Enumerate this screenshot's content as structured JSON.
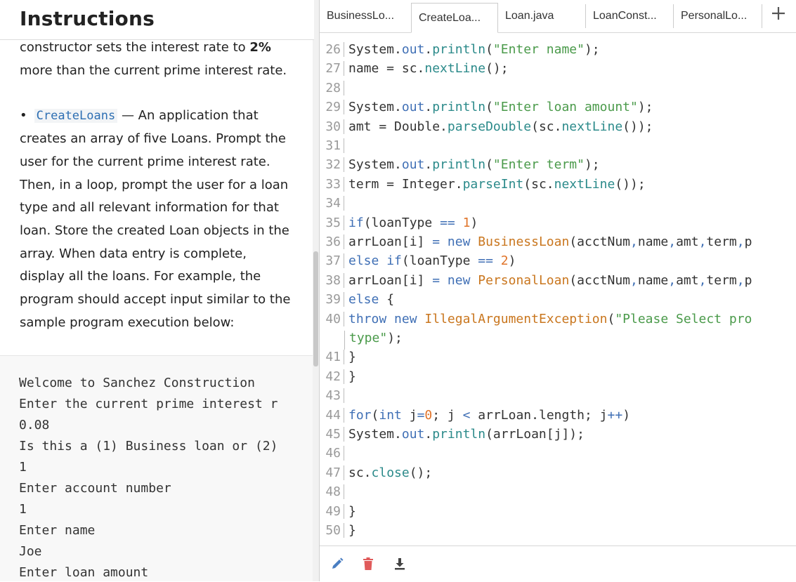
{
  "instructions": {
    "title": "Instructions",
    "para1_line1_text": "constructor sets the interest rate to ",
    "para1_line1_bold": "2%",
    "para1_line2": "more than the current prime interest rate.",
    "bullet": "•",
    "class_name": "CreateLoans",
    "bullet_line1_rest": " — An application that",
    "bullet_lines": [
      "creates an array of five Loans. Prompt the",
      "user for the current prime interest rate.",
      "Then, in a loop, prompt the user for a loan",
      "type and all relevant information for that",
      "loan. Store the created Loan objects in the",
      "array. When data entry is complete,",
      "display all the loans. For example, the",
      "program should accept input similar to the",
      "sample program execution below:"
    ]
  },
  "sample_output": [
    "Welcome to Sanchez Construction",
    "Enter the current prime interest r",
    "0.08",
    "Is this a (1) Business loan or (2)",
    "1",
    "Enter account number",
    "1",
    "Enter name",
    "Joe",
    "Enter loan amount"
  ],
  "tabs": [
    {
      "label": "BusinessLo..."
    },
    {
      "label": "CreateLoa..."
    },
    {
      "label": "Loan.java"
    },
    {
      "label": "LoanConst..."
    },
    {
      "label": "PersonalLo..."
    }
  ],
  "add_tab_icon": "plus-icon",
  "code_lines": [
    {
      "num": "26",
      "segs": [
        [
          "System.",
          ""
        ],
        [
          "out",
          "k"
        ],
        [
          ".",
          ""
        ],
        [
          "println",
          "m"
        ],
        [
          "(",
          ""
        ],
        [
          "\"Enter name\"",
          "s"
        ],
        [
          ");",
          ""
        ]
      ]
    },
    {
      "num": "27",
      "segs": [
        [
          "name = sc.",
          ""
        ],
        [
          "nextLine",
          "m"
        ],
        [
          "();",
          ""
        ]
      ]
    },
    {
      "num": "28",
      "segs": []
    },
    {
      "num": "29",
      "segs": [
        [
          "System.",
          ""
        ],
        [
          "out",
          "k"
        ],
        [
          ".",
          ""
        ],
        [
          "println",
          "m"
        ],
        [
          "(",
          ""
        ],
        [
          "\"Enter loan amount\"",
          "s"
        ],
        [
          ");",
          ""
        ]
      ]
    },
    {
      "num": "30",
      "segs": [
        [
          "amt = Double.",
          ""
        ],
        [
          "parseDouble",
          "m"
        ],
        [
          "(sc.",
          ""
        ],
        [
          "nextLine",
          "m"
        ],
        [
          "());",
          ""
        ]
      ]
    },
    {
      "num": "31",
      "segs": []
    },
    {
      "num": "32",
      "segs": [
        [
          "System.",
          ""
        ],
        [
          "out",
          "k"
        ],
        [
          ".",
          ""
        ],
        [
          "println",
          "m"
        ],
        [
          "(",
          ""
        ],
        [
          "\"Enter term\"",
          "s"
        ],
        [
          ");",
          ""
        ]
      ]
    },
    {
      "num": "33",
      "segs": [
        [
          "term = Integer.",
          ""
        ],
        [
          "parseInt",
          "m"
        ],
        [
          "(sc.",
          ""
        ],
        [
          "nextLine",
          "m"
        ],
        [
          "());",
          ""
        ]
      ]
    },
    {
      "num": "34",
      "segs": []
    },
    {
      "num": "35",
      "segs": [
        [
          "if",
          "k"
        ],
        [
          "(loanType ",
          ""
        ],
        [
          "==",
          "p"
        ],
        [
          " ",
          ""
        ],
        [
          "1",
          "n"
        ],
        [
          ")",
          ""
        ]
      ]
    },
    {
      "num": "36",
      "segs": [
        [
          "arrLoan[i] ",
          ""
        ],
        [
          "=",
          "p"
        ],
        [
          " ",
          ""
        ],
        [
          "new",
          "k"
        ],
        [
          " ",
          ""
        ],
        [
          "BusinessLoan",
          "t"
        ],
        [
          "(acctNum",
          ""
        ],
        [
          ",",
          "p"
        ],
        [
          "name",
          ""
        ],
        [
          ",",
          "p"
        ],
        [
          "amt",
          ""
        ],
        [
          ",",
          "p"
        ],
        [
          "term",
          ""
        ],
        [
          ",",
          "p"
        ],
        [
          "p",
          ""
        ]
      ]
    },
    {
      "num": "37",
      "segs": [
        [
          "else",
          "k"
        ],
        [
          " ",
          ""
        ],
        [
          "if",
          "k"
        ],
        [
          "(loanType ",
          ""
        ],
        [
          "==",
          "p"
        ],
        [
          " ",
          ""
        ],
        [
          "2",
          "n"
        ],
        [
          ")",
          ""
        ]
      ]
    },
    {
      "num": "38",
      "segs": [
        [
          "arrLoan[i] ",
          ""
        ],
        [
          "=",
          "p"
        ],
        [
          " ",
          ""
        ],
        [
          "new",
          "k"
        ],
        [
          " ",
          ""
        ],
        [
          "PersonalLoan",
          "t"
        ],
        [
          "(acctNum",
          ""
        ],
        [
          ",",
          "p"
        ],
        [
          "name",
          ""
        ],
        [
          ",",
          "p"
        ],
        [
          "amt",
          ""
        ],
        [
          ",",
          "p"
        ],
        [
          "term",
          ""
        ],
        [
          ",",
          "p"
        ],
        [
          "p",
          ""
        ]
      ]
    },
    {
      "num": "39",
      "segs": [
        [
          "else",
          "k"
        ],
        [
          " {",
          ""
        ]
      ]
    },
    {
      "num": "40",
      "segs": [
        [
          "throw",
          "k"
        ],
        [
          " ",
          ""
        ],
        [
          "new",
          "k"
        ],
        [
          " ",
          ""
        ],
        [
          "IllegalArgumentException",
          "t"
        ],
        [
          "(",
          ""
        ],
        [
          "\"Please Select pro",
          "s"
        ]
      ]
    },
    {
      "num": "",
      "segs": [
        [
          "type\"",
          "s"
        ],
        [
          ");",
          ""
        ]
      ]
    },
    {
      "num": "41",
      "segs": [
        [
          "}",
          ""
        ]
      ]
    },
    {
      "num": "42",
      "segs": [
        [
          "}",
          ""
        ]
      ]
    },
    {
      "num": "43",
      "segs": []
    },
    {
      "num": "44",
      "segs": [
        [
          "for",
          "k"
        ],
        [
          "(",
          ""
        ],
        [
          "int",
          "k"
        ],
        [
          " j",
          ""
        ],
        [
          "=",
          "p"
        ],
        [
          "0",
          "n"
        ],
        [
          "; j ",
          ""
        ],
        [
          "<",
          "p"
        ],
        [
          " arrLoan.length; j",
          ""
        ],
        [
          "++",
          "p"
        ],
        [
          ")",
          ""
        ]
      ]
    },
    {
      "num": "45",
      "segs": [
        [
          "System.",
          ""
        ],
        [
          "out",
          "k"
        ],
        [
          ".",
          ""
        ],
        [
          "println",
          "m"
        ],
        [
          "(arrLoan[j]);",
          ""
        ]
      ]
    },
    {
      "num": "46",
      "segs": []
    },
    {
      "num": "47",
      "segs": [
        [
          "sc.",
          ""
        ],
        [
          "close",
          "m"
        ],
        [
          "();",
          ""
        ]
      ]
    },
    {
      "num": "48",
      "segs": []
    },
    {
      "num": "49",
      "segs": [
        [
          "}",
          ""
        ]
      ]
    },
    {
      "num": "50",
      "segs": [
        [
          "}",
          ""
        ]
      ]
    }
  ],
  "bottom_toolbar": {
    "edit_icon": "pencil-icon",
    "delete_icon": "trash-icon",
    "download_icon": "download-icon",
    "colors": {
      "edit": "#4a7ec2",
      "delete": "#e05a5a",
      "download": "#444444"
    }
  }
}
